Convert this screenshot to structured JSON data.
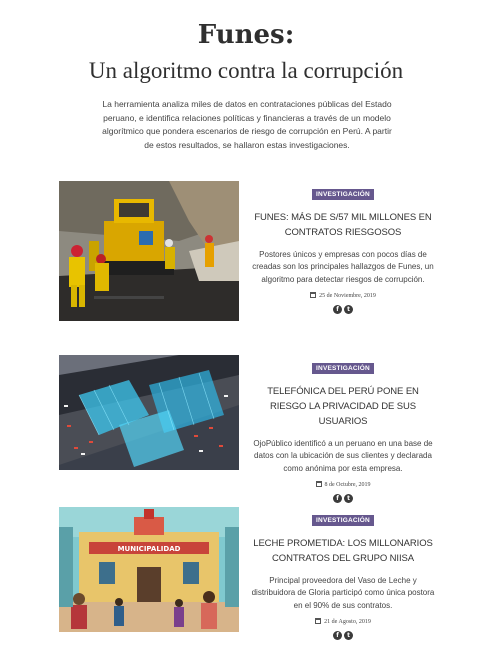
{
  "header": {
    "title": "Funes:",
    "subtitle": "Un algoritmo contra la corrupción",
    "intro": "La herramienta analiza miles de datos en contrataciones públicas del Estado peruano, e identifica relaciones políticas y financieras a través de un modelo algorítmico que pondera escenarios de riesgo de corrupción en Perú. A partir de estos resultados, se hallaron estas investigaciones."
  },
  "colors": {
    "badge": "#66588e",
    "text": "#333333",
    "social": "#3b3b3b"
  },
  "articles": [
    {
      "badge": "INVESTIGACIÓN",
      "headline": "FUNES: MÁS DE S/57 MIL MILLONES EN CONTRATOS RIESGOSOS",
      "summary": "Postores únicos y empresas con pocos días de creadas son los principales hallazgos de Funes, un algoritmo para detectar riesgos de corrupción.",
      "date": "25 de Noviembre, 2019",
      "image": "road-workers-paving-photo"
    },
    {
      "badge": "INVESTIGACIÓN",
      "headline": "TELEFÓNICA DEL PERÚ PONE EN RIESGO LA PRIVACIDAD DE SUS USUARIOS",
      "summary": "OjoPúblico identificó a un peruano en una base de datos con la ubicación de sus clientes y declarada como anónima por esta empresa.",
      "date": "8 de Octubre, 2019",
      "image": "city-traffic-data-illustration"
    },
    {
      "badge": "INVESTIGACIÓN",
      "headline": "LECHE PROMETIDA: LOS MILLONARIOS CONTRATOS DEL GRUPO NIISA",
      "summary": "Principal proveedora del Vaso de Leche y distribuidora de Gloria participó como única postora en el 90% de sus contratos.",
      "date": "21 de Agosto, 2019",
      "image": "municipalidad-illustration",
      "image_text": "MUNICIPALIDAD"
    }
  ],
  "social_icons": {
    "facebook": "f",
    "twitter": "t"
  }
}
